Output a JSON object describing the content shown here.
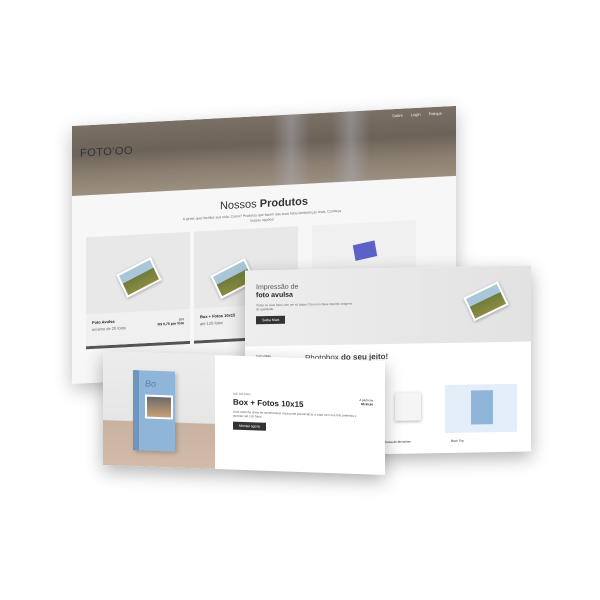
{
  "site": {
    "logo": "FOTO'OO",
    "nav": [
      "Sobre",
      "Login",
      "Fotique"
    ]
  },
  "products": {
    "title_light": "Nossos",
    "title_bold": "Produtos",
    "subtitle": "A gente quer facilitar sua vida. Como? Produtos que fazem das suas fotos lembranças reais. Conheça nossas opções!",
    "cards": [
      {
        "name": "Foto Avulsa",
        "detail": "mínimo de 20 fotos",
        "price_label": "por",
        "price": "R$ 0,75 por foto"
      },
      {
        "name": "Box + Fotos 10x15",
        "detail": "até 120 fotos",
        "price_label": "",
        "price": ""
      },
      {
        "name": "",
        "detail": "",
        "price_label": "",
        "price": ""
      }
    ]
  },
  "avulsa": {
    "title_light": "Impressão de",
    "title_bold": "foto avulsa",
    "text": "Todas as suas fotos com um só clique! Com um clique imprime imagens de qualidade.",
    "button": "Saiba Mais",
    "section_label": "Saiba Mais",
    "photobox_light": "Photobox",
    "photobox_bold": "do seu jeito!",
    "items": [
      "Caixa de Memórias",
      "Book Trip"
    ]
  },
  "box": {
    "eyebrow": "Até 120 fotos",
    "title": "Box + Fotos 10x15",
    "text": "Uma caixinha cheia de sentimentos! Você pode personalizar a capa com sua foto preferida e guardar até 120 fotos.",
    "price_label": "A partir de",
    "price": "R$ 99,90",
    "button": "Montar agora"
  }
}
